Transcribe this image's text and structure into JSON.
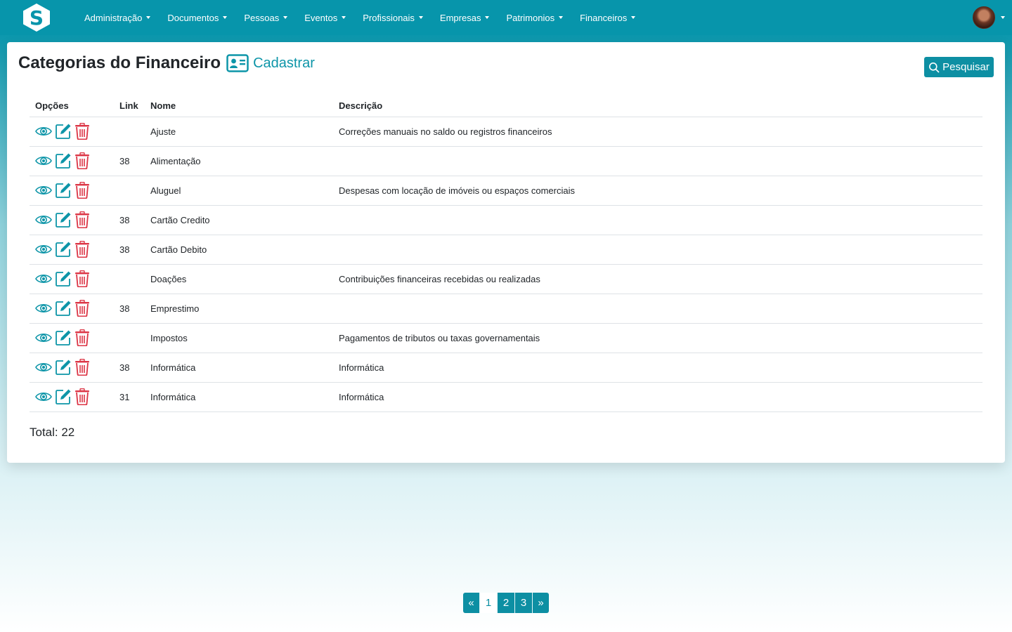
{
  "nav": {
    "items": [
      {
        "label": "Administração"
      },
      {
        "label": "Documentos"
      },
      {
        "label": "Pessoas"
      },
      {
        "label": "Eventos"
      },
      {
        "label": "Profissionais"
      },
      {
        "label": "Empresas"
      },
      {
        "label": "Patrimonios"
      },
      {
        "label": "Financeiros"
      }
    ]
  },
  "header": {
    "title": "Categorias do Financeiro",
    "cadastrar_label": "Cadastrar",
    "search_label": "Pesquisar"
  },
  "table": {
    "columns": [
      "Opções",
      "Link",
      "Nome",
      "Descrição"
    ],
    "rows": [
      {
        "link": "",
        "nome": "Ajuste",
        "descricao": "Correções manuais no saldo ou registros financeiros"
      },
      {
        "link": "38",
        "nome": "Alimentação",
        "descricao": ""
      },
      {
        "link": "",
        "nome": "Aluguel",
        "descricao": "Despesas com locação de imóveis ou espaços comerciais"
      },
      {
        "link": "38",
        "nome": "Cartão Credito",
        "descricao": ""
      },
      {
        "link": "38",
        "nome": "Cartão Debito",
        "descricao": ""
      },
      {
        "link": "",
        "nome": "Doações",
        "descricao": "Contribuições financeiras recebidas ou realizadas"
      },
      {
        "link": "38",
        "nome": "Emprestimo",
        "descricao": ""
      },
      {
        "link": "",
        "nome": "Impostos",
        "descricao": "Pagamentos de tributos ou taxas governamentais"
      },
      {
        "link": "38",
        "nome": "Informática",
        "descricao": "Informática"
      },
      {
        "link": "31",
        "nome": "Informática",
        "descricao": "Informática"
      }
    ]
  },
  "total_label": "Total: 22",
  "pagination": {
    "prev": "«",
    "pages": [
      "1",
      "2",
      "3"
    ],
    "next": "»",
    "current": "1"
  },
  "colors": {
    "primary": "#0795ab",
    "accent": "#0d95a8",
    "danger": "#dc3545"
  },
  "icons": {
    "view": "eye-icon",
    "edit": "edit-icon",
    "delete": "trash-icon",
    "cadastrar": "id-card-icon",
    "search": "search-icon"
  }
}
